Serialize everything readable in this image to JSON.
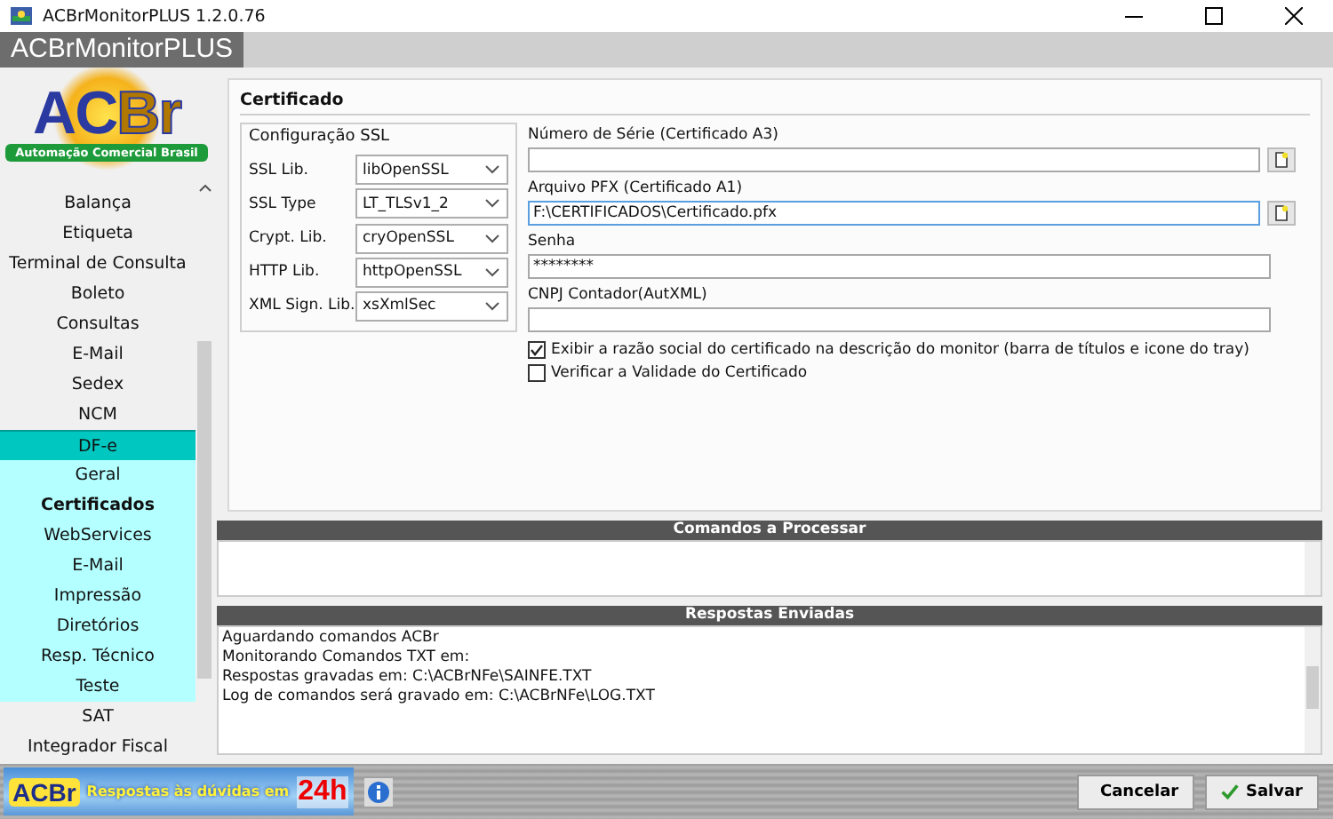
{
  "window": {
    "title": "ACBrMonitorPLUS 1.2.0.76"
  },
  "header": {
    "title": "ACBrMonitorPLUS"
  },
  "logo": {
    "brand_first": "AC",
    "brand_second": "Br",
    "tagline": "Automação Comercial Brasil"
  },
  "sidebar": {
    "items": [
      {
        "label": "Balança",
        "selected": false,
        "expanded": false
      },
      {
        "label": "Etiqueta",
        "selected": false,
        "expanded": false
      },
      {
        "label": "Terminal de Consulta",
        "selected": false,
        "expanded": false
      },
      {
        "label": "Boleto",
        "selected": false,
        "expanded": false
      },
      {
        "label": "Consultas",
        "selected": false,
        "expanded": false
      },
      {
        "label": "E-Mail",
        "selected": false,
        "expanded": false
      },
      {
        "label": "Sedex",
        "selected": false,
        "expanded": false
      },
      {
        "label": "NCM",
        "selected": false,
        "expanded": false
      },
      {
        "label": "DF-e",
        "selected": false,
        "expanded": true,
        "children": [
          {
            "label": "Geral",
            "selected": false
          },
          {
            "label": "Certificados",
            "selected": true
          },
          {
            "label": "WebServices",
            "selected": false
          },
          {
            "label": "E-Mail",
            "selected": false
          },
          {
            "label": "Impressão",
            "selected": false
          },
          {
            "label": "Diretórios",
            "selected": false
          },
          {
            "label": "Resp. Técnico",
            "selected": false
          },
          {
            "label": "Teste",
            "selected": false
          }
        ]
      },
      {
        "label": "SAT",
        "selected": false,
        "expanded": false
      },
      {
        "label": "Integrador Fiscal",
        "selected": false,
        "expanded": false
      }
    ]
  },
  "certificado": {
    "title": "Certificado",
    "ssl_group": {
      "title": "Configuração SSL",
      "rows": [
        {
          "label": "SSL Lib.",
          "value": "libOpenSSL"
        },
        {
          "label": "SSL Type",
          "value": "LT_TLSv1_2"
        },
        {
          "label": "Crypt. Lib.",
          "value": "cryOpenSSL"
        },
        {
          "label": "HTTP Lib.",
          "value": "httpOpenSSL"
        },
        {
          "label": "XML Sign. Lib.",
          "value": "xsXmlSec"
        }
      ]
    },
    "fields": [
      {
        "label": "Número de Série (Certificado A3)",
        "browse": true,
        "focused": false
      },
      {
        "label": "Arquivo PFX (Certificado A1)",
        "value": "F:\\CERTIFICADOS\\Certificado.pfx",
        "browse": true,
        "focused": true
      },
      {
        "label": "Senha",
        "value": "********",
        "browse": false,
        "focused": false
      },
      {
        "label": "CNPJ Contador(AutXML)",
        "browse": false,
        "focused": false
      }
    ],
    "checkboxes": [
      {
        "label": "Exibir a razão social do certificado na descrição do monitor (barra de títulos e icone do tray)",
        "checked": true
      },
      {
        "label": "Verificar a Validade do Certificado",
        "checked": false
      }
    ]
  },
  "commands_panel": {
    "title": "Comandos a Processar"
  },
  "responses_panel": {
    "title": "Respostas Enviadas",
    "lines": [
      "Aguardando comandos ACBr",
      "Monitorando Comandos TXT em:",
      "Respostas gravadas em: C:\\ACBrNFe\\SAINFE.TXT",
      "Log de comandos será gravado em: C:\\ACBrNFe\\LOG.TXT"
    ]
  },
  "footer": {
    "banner": {
      "brand": "ACBr",
      "text": "Respostas às dúvidas em",
      "highlight": "24h"
    },
    "buttons": [
      {
        "label": "Cancelar",
        "kind": "cancel"
      },
      {
        "label": "Salvar",
        "kind": "save"
      }
    ]
  }
}
